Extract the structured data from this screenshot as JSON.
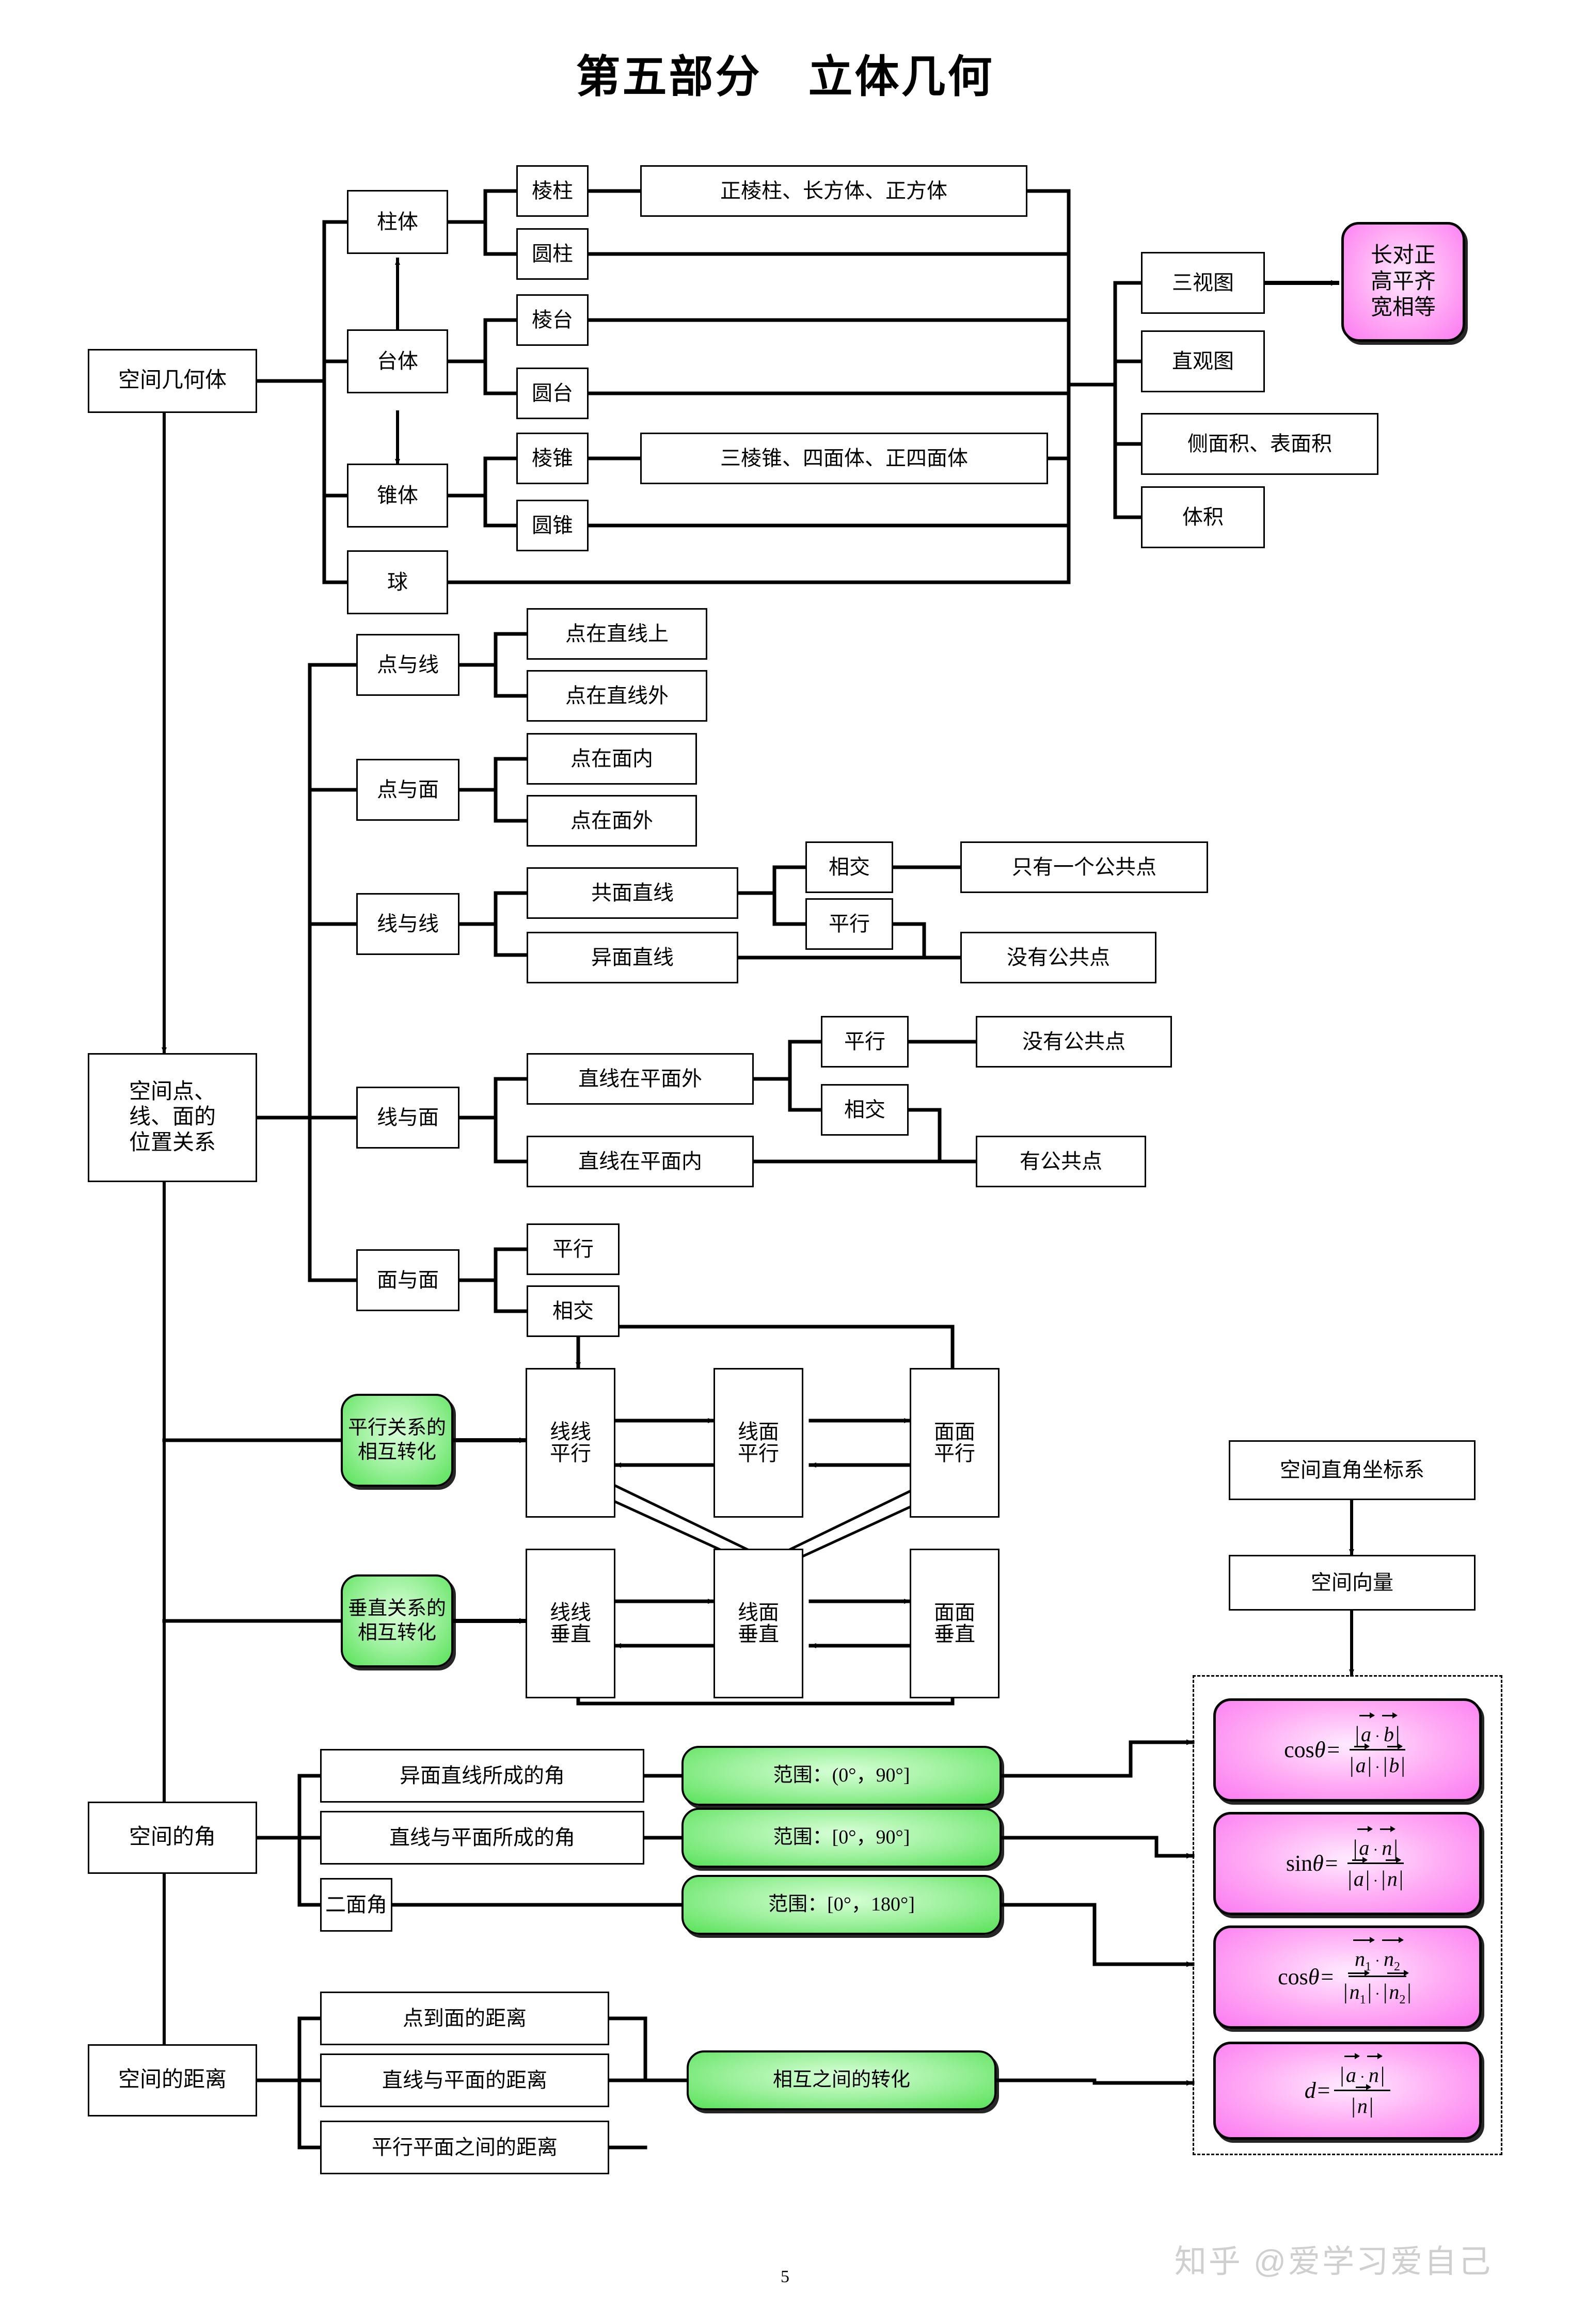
{
  "title": "第五部分　立体几何",
  "page_number": "5",
  "watermark": "知乎 @爱学习爱自己",
  "colors": {
    "green_fill": "#8ef08e",
    "pink_fill": "#ff9bf0",
    "stroke": "#000000",
    "background": "#ffffff"
  },
  "solids": {
    "root": "空间几何体",
    "level1": [
      {
        "label": "柱体"
      },
      {
        "label": "台体"
      },
      {
        "label": "锥体"
      },
      {
        "label": "球"
      }
    ],
    "level2": [
      {
        "label": "棱柱"
      },
      {
        "label": "圆柱"
      },
      {
        "label": "棱台"
      },
      {
        "label": "圆台"
      },
      {
        "label": "棱锥"
      },
      {
        "label": "圆锥"
      }
    ],
    "level3": [
      {
        "label": "正棱柱、长方体、正方体"
      },
      {
        "label": "三棱锥、四面体、正四面体"
      }
    ],
    "right_column": [
      {
        "label": "三视图"
      },
      {
        "label": "直观图"
      },
      {
        "label": "侧面积、表面积"
      },
      {
        "label": "体积"
      }
    ],
    "three_view_rule": "长对正\n高平齐\n宽相等"
  },
  "positions": {
    "root": "空间点、\n线、面的\n位置关系",
    "categories": [
      {
        "label": "点与线"
      },
      {
        "label": "点与面"
      },
      {
        "label": "线与线"
      },
      {
        "label": "线与面"
      },
      {
        "label": "面与面"
      }
    ],
    "point_line": [
      "点在直线上",
      "点在直线外"
    ],
    "point_plane": [
      "点在面内",
      "点在面外"
    ],
    "line_line": [
      "共面直线",
      "异面直线"
    ],
    "line_line_sub": [
      "相交",
      "平行"
    ],
    "line_line_result": [
      "只有一个公共点",
      "没有公共点"
    ],
    "line_plane": [
      "直线在平面外",
      "直线在平面内"
    ],
    "line_plane_sub": [
      "平行",
      "相交"
    ],
    "line_plane_result": [
      "没有公共点",
      "有公共点"
    ],
    "plane_plane": [
      "平行",
      "相交"
    ]
  },
  "transforms": {
    "parallel_title": "平行关系的\n相互转化",
    "perpendicular_title": "垂直关系的\n相互转化",
    "parallel_nodes": [
      "线线\n平行",
      "线面\n平行",
      "面面\n平行"
    ],
    "perpendicular_nodes": [
      "线线\n垂直",
      "线面\n垂直",
      "面面\n垂直"
    ]
  },
  "vectors": {
    "coord_system": "空间直角坐标系",
    "space_vector": "空间向量",
    "formulas": [
      {
        "name": "angle-between-skew-lines",
        "lead": "cos",
        "theta": "θ",
        "numerator": "| a⃗ · b⃗ |",
        "denominator": "| a⃗ | · | b⃗ |"
      },
      {
        "name": "angle-line-plane",
        "lead": "sin",
        "theta": "θ",
        "numerator": "| a⃗ · n⃗ |",
        "denominator": "| a⃗ | · | n⃗ |"
      },
      {
        "name": "dihedral-angle",
        "lead": "cos",
        "theta": "θ",
        "numerator": "n⃗₁ · n⃗₂",
        "denominator": "| n⃗₁ | · | n⃗₂ |"
      },
      {
        "name": "distance",
        "lead": "d",
        "theta": "",
        "numerator": "| a⃗ · n⃗ |",
        "denominator": "| n⃗ |"
      }
    ]
  },
  "angles": {
    "root": "空间的角",
    "items": [
      "异面直线所成的角",
      "直线与平面所成的角",
      "二面角"
    ],
    "ranges": [
      "范围：(0°，90°]",
      "范围：[0°，90°]",
      "范围：[0°，180°]"
    ]
  },
  "distances": {
    "root": "空间的距离",
    "items": [
      "点到面的距离",
      "直线与平面的距离",
      "平行平面之间的距离"
    ],
    "conversion": "相互之间的转化"
  }
}
